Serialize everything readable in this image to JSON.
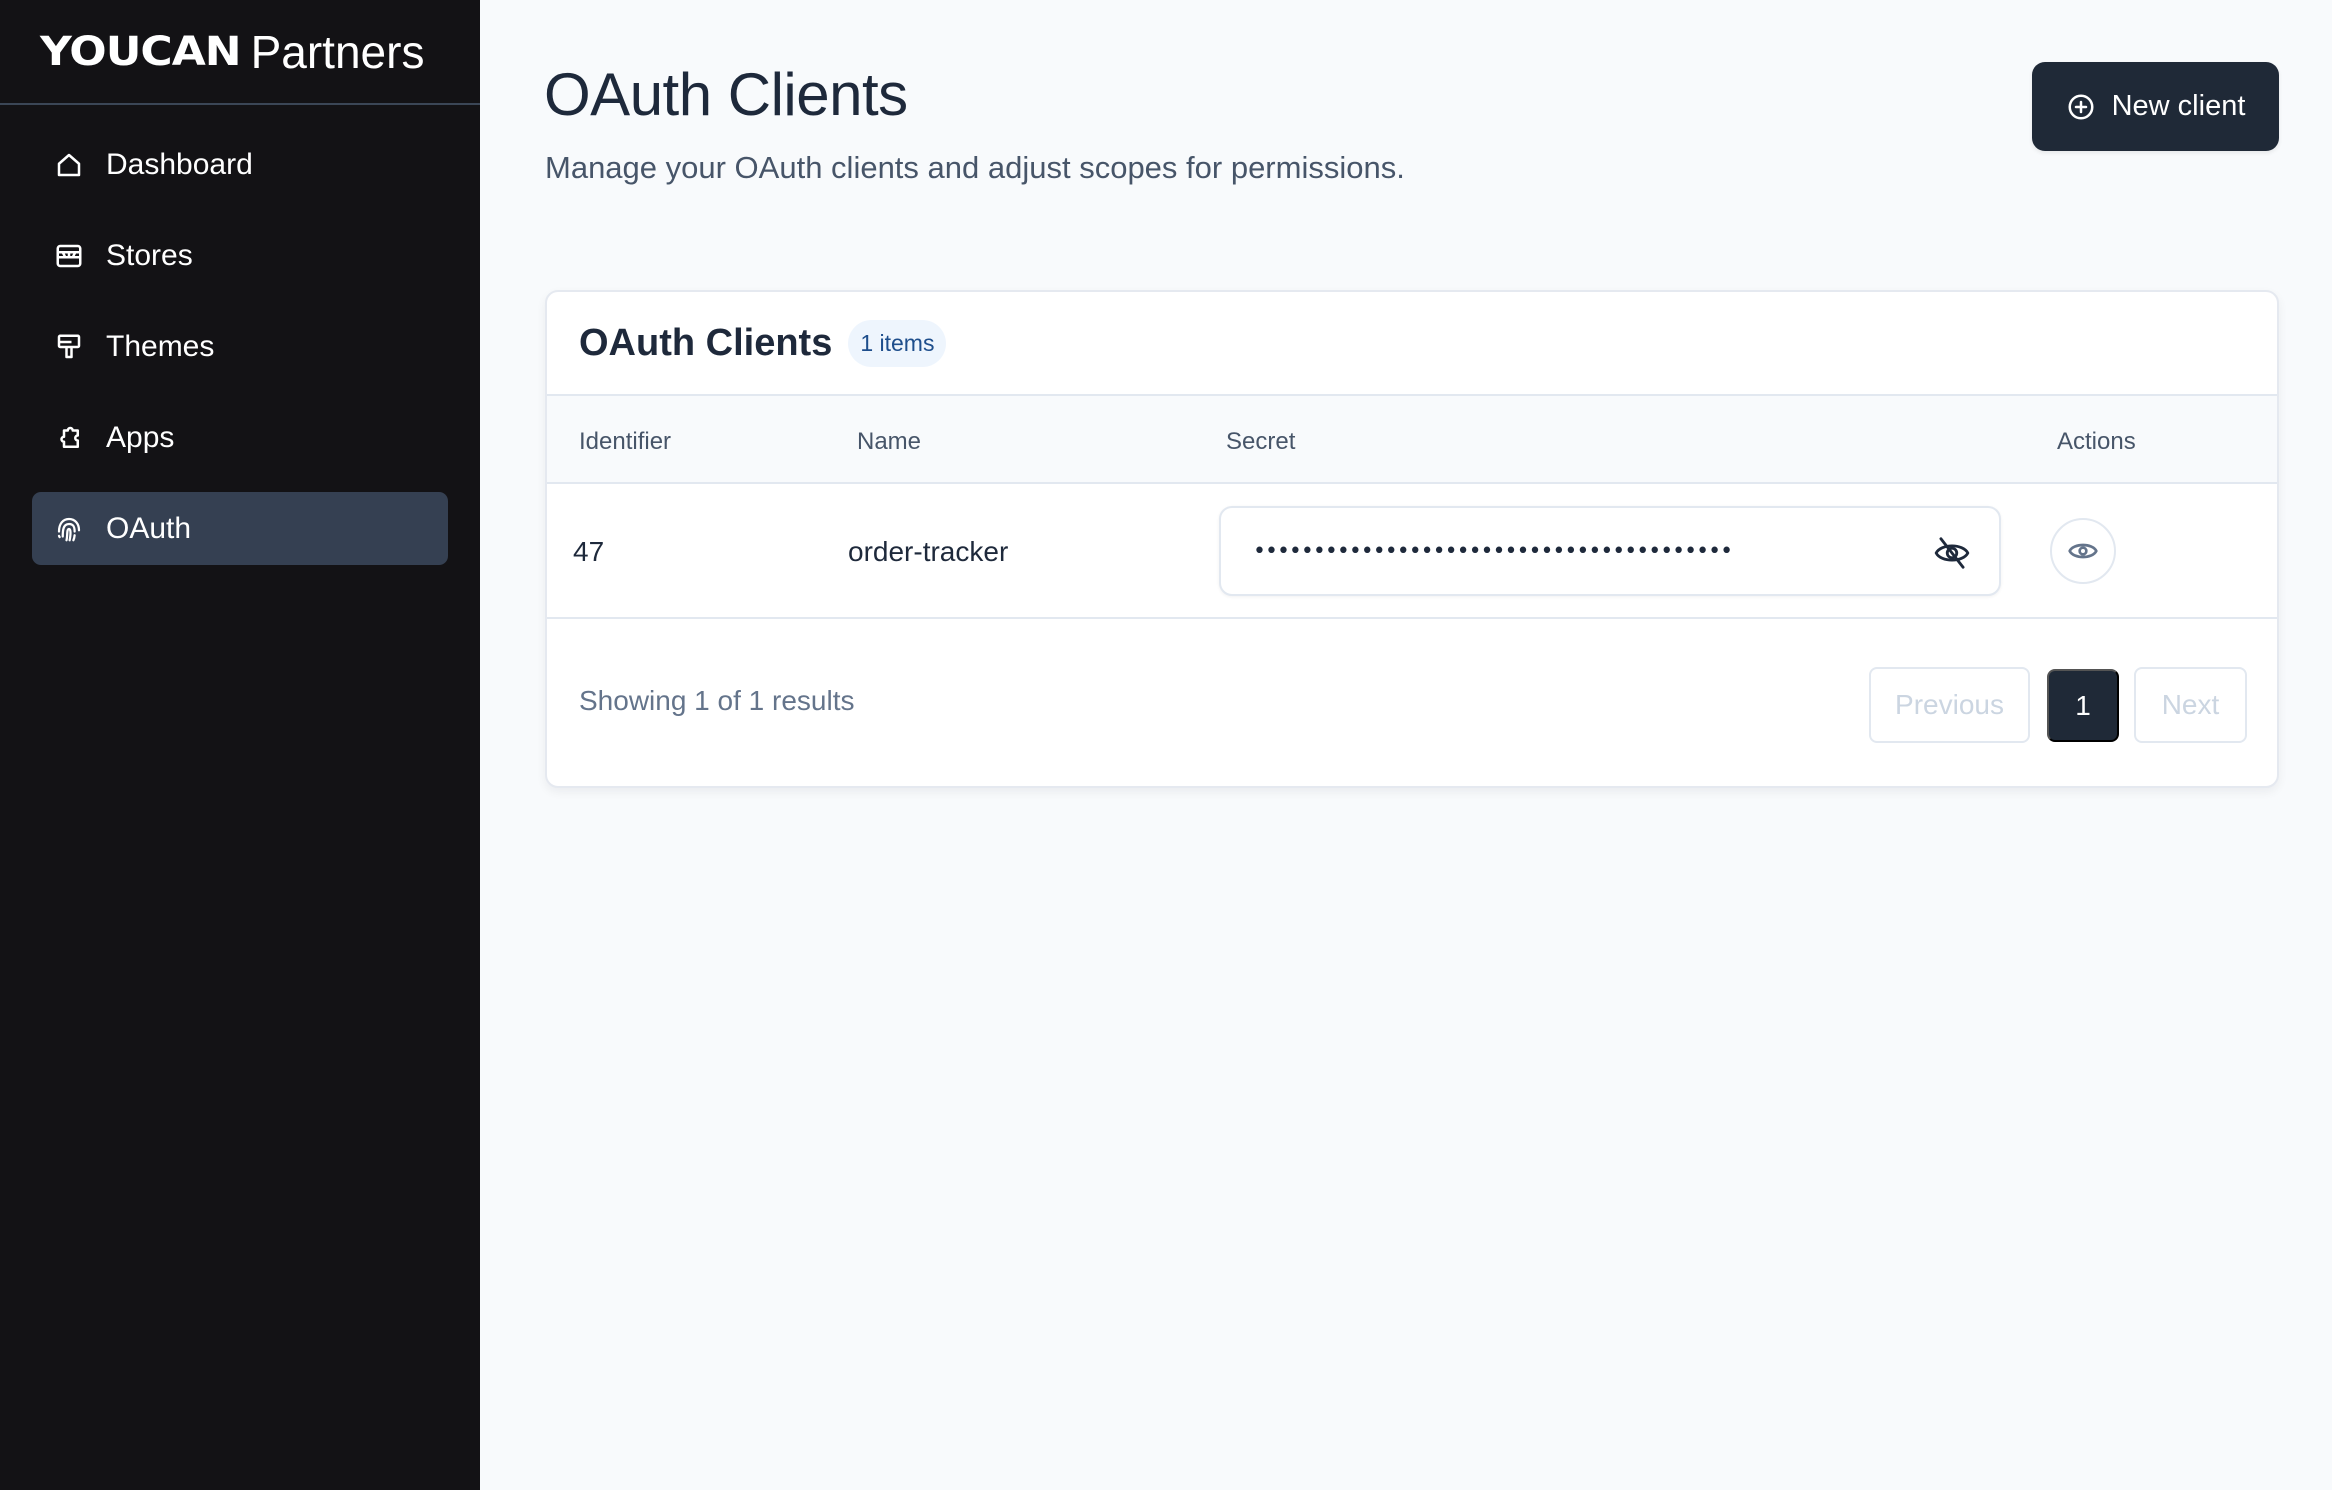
{
  "brand": {
    "logo_text": "YOUCAN",
    "logo_suffix": "Partners"
  },
  "sidebar": {
    "items": [
      {
        "label": "Dashboard",
        "icon": "home-icon",
        "active": false
      },
      {
        "label": "Stores",
        "icon": "store-icon",
        "active": false
      },
      {
        "label": "Themes",
        "icon": "paint-roller-icon",
        "active": false
      },
      {
        "label": "Apps",
        "icon": "puzzle-icon",
        "active": false
      },
      {
        "label": "OAuth",
        "icon": "fingerprint-icon",
        "active": true
      }
    ]
  },
  "header": {
    "title": "OAuth Clients",
    "subtitle": "Manage your OAuth clients and adjust scopes for permissions.",
    "new_client_label": "New client",
    "new_client_icon": "plus-circle-icon"
  },
  "card": {
    "title": "OAuth Clients",
    "badge": "1 items",
    "columns": [
      "Identifier",
      "Name",
      "Secret",
      "Actions"
    ],
    "rows": [
      {
        "identifier": "47",
        "name": "order-tracker",
        "secret_masked": "••••••••••••••••••••••••••••••••••••••••",
        "secret_toggle_icon": "eye-off-icon",
        "action_icon": "eye-icon"
      }
    ],
    "footer": {
      "results_text": "Showing 1 of 1 results",
      "previous_label": "Previous",
      "current_page": "1",
      "next_label": "Next"
    }
  },
  "colors": {
    "sidebar_bg": "#131215",
    "sidebar_active": "#354052",
    "primary_button": "#1f2937",
    "page_bg": "#f8fafc",
    "badge_bg": "#eef5fd",
    "badge_text": "#1e4e8c"
  }
}
